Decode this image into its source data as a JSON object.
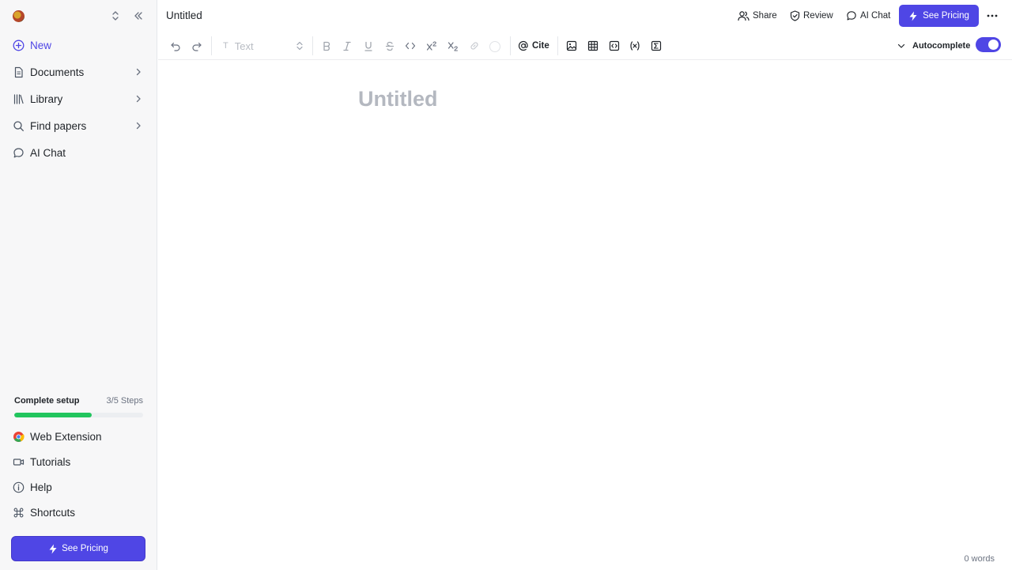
{
  "sidebar": {
    "items": [
      {
        "label": "New"
      },
      {
        "label": "Documents"
      },
      {
        "label": "Library"
      },
      {
        "label": "Find papers"
      },
      {
        "label": "AI Chat"
      }
    ],
    "setup": {
      "title": "Complete setup",
      "steps": "3/5 Steps",
      "progress": 0.6
    },
    "bottom_items": [
      {
        "label": "Web Extension"
      },
      {
        "label": "Tutorials"
      },
      {
        "label": "Help"
      },
      {
        "label": "Shortcuts"
      }
    ],
    "pricing_label": "See Pricing"
  },
  "header": {
    "doc_title": "Untitled",
    "share_label": "Share",
    "review_label": "Review",
    "ai_chat_label": "AI Chat",
    "pricing_label": "See Pricing"
  },
  "toolbar": {
    "text_style": "Text",
    "cite_label": "Cite",
    "autocomplete_label": "Autocomplete",
    "autocomplete_on": true
  },
  "editor": {
    "title_placeholder": "Untitled",
    "word_count": "0 words"
  },
  "colors": {
    "accent": "#4f46e5",
    "progress": "#22c55e",
    "placeholder": "#b4b8c0"
  }
}
